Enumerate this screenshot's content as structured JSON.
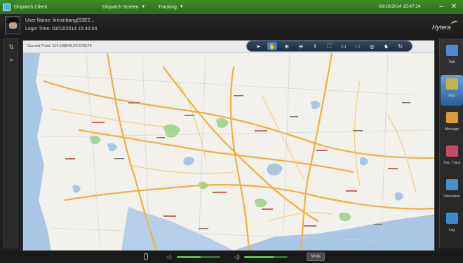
{
  "window": {
    "title": "Dispatch Client",
    "menus": [
      {
        "label": "Dispatch Screen"
      },
      {
        "label": "Tracking"
      }
    ],
    "datetime": "03/10/2014 15:47:24",
    "minimize_icon": "minimize-icon",
    "close_icon": "close-icon"
  },
  "header": {
    "user_name": "User Name: linminbang(S3E2...",
    "login_time": "Login Time: 03/10/2014 15:40:54",
    "logo": "Hytera"
  },
  "map": {
    "coordinate_text": "Current Point: 114.198040,22.675676",
    "tools": [
      {
        "icon": "cursor-icon",
        "glyph": "➤"
      },
      {
        "icon": "pan-hand-icon",
        "glyph": "✋",
        "active": true
      },
      {
        "icon": "zoom-in-icon",
        "glyph": "⊕"
      },
      {
        "icon": "zoom-out-icon",
        "glyph": "⊖"
      },
      {
        "icon": "export-icon",
        "glyph": "⇪"
      },
      {
        "icon": "fullscreen-icon",
        "glyph": "⛶"
      },
      {
        "icon": "measure-icon",
        "glyph": "▭"
      },
      {
        "icon": "select-rectangle-icon",
        "glyph": "□"
      },
      {
        "icon": "select-circle-icon",
        "glyph": "◎"
      },
      {
        "icon": "locate-icon",
        "glyph": "♞"
      },
      {
        "icon": "refresh-icon",
        "glyph": "↻"
      }
    ]
  },
  "sidebar": {
    "items": [
      {
        "label": "Talk",
        "icon": "talk-icon",
        "color": "#4a8ad0"
      },
      {
        "label": "Map",
        "icon": "map-icon",
        "color": "#c6b24a",
        "active": true
      },
      {
        "label": "Message",
        "icon": "message-icon",
        "color": "#d89a3a"
      },
      {
        "label": "Trac. Track",
        "icon": "track-icon",
        "color": "#c84a6a"
      },
      {
        "label": "Dimension",
        "icon": "dimension-icon",
        "color": "#4a90c8"
      },
      {
        "label": "Log",
        "icon": "log-icon",
        "color": "#3a8ad0"
      }
    ]
  },
  "bottom": {
    "mic_level": 0.55,
    "speaker_level": 0.7,
    "mute_label": "Mute"
  },
  "colors": {
    "titlebar": "#3f8a2a",
    "road_major": "#f2b040",
    "water": "#a9c6e4",
    "green": "#a6d596"
  }
}
